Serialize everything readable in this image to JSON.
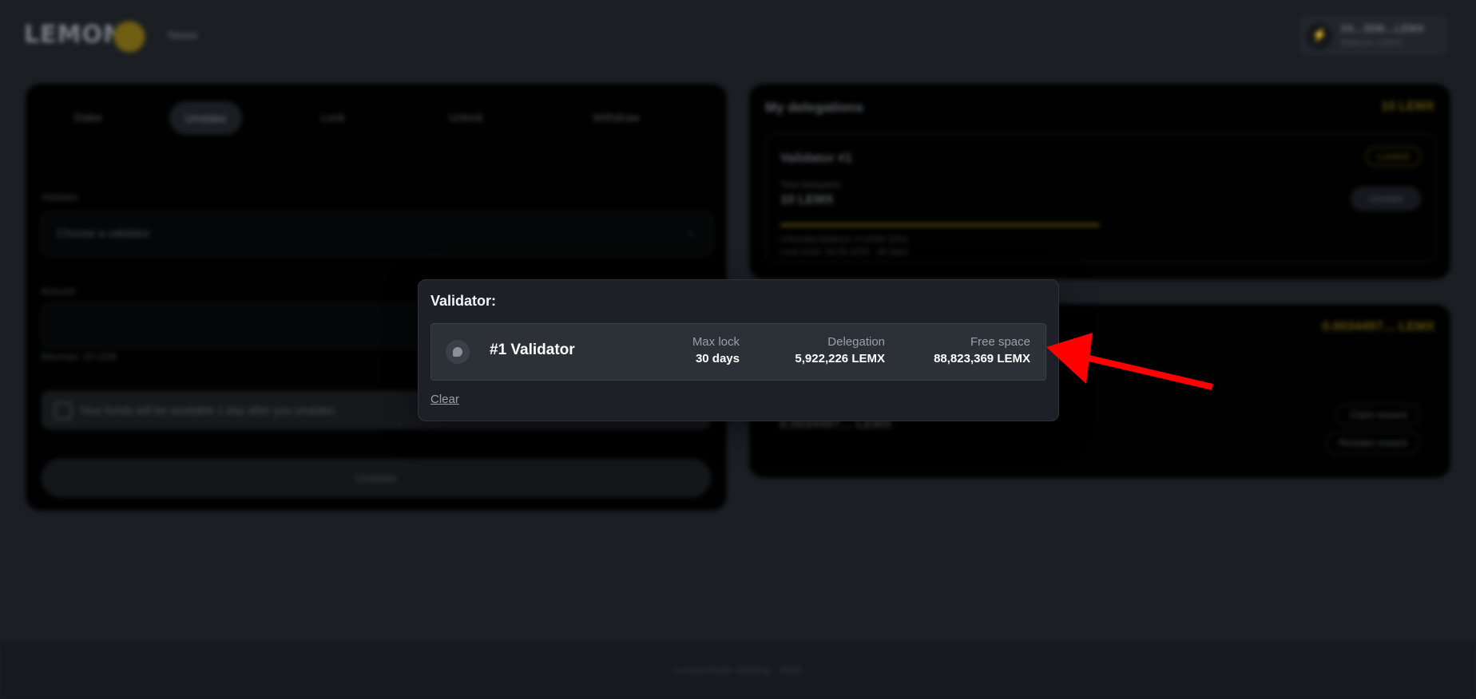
{
  "header": {
    "logo_text": "LEMON",
    "nav_news": "News",
    "wallet_address": "0X…5DB…LEMX",
    "wallet_sub": "Balance: LEMX"
  },
  "stake_panel": {
    "tabs": [
      "Stake",
      "Unstake",
      "Lock",
      "Unlock",
      "Withdraw"
    ],
    "active_tab": "Unstake",
    "validator_label": "Validator",
    "validator_placeholder": "Choose a validator",
    "amount_label": "Amount",
    "amount_hint": "Min/max: 10 LEM",
    "notice": "Your funds will be available 1 day after you unstake.",
    "submit_label": "Unstake"
  },
  "delegations_panel": {
    "title": "My delegations",
    "total": "10 LEMX",
    "card_title": "Validator #1",
    "badge": "Locked",
    "sub_label": "Total delegated",
    "value": "10 LEMX",
    "action_label": "Unstake",
    "line1": "Unlocked balance: 0 LEMX (0%)",
    "line2": "Lock ends: 30.06.2025 · 30 days"
  },
  "rewards_panel": {
    "amount": "0.0034497… LEMX",
    "value": "0.0034497… LEMX",
    "claim_label": "Claim reward",
    "restake_label": "Restake reward"
  },
  "footer": {
    "text": "LemonChain Staking · 2025"
  },
  "modal": {
    "title": "Validator:",
    "validators": [
      {
        "name": "#1 Validator",
        "max_lock_label": "Max lock",
        "max_lock": "30 days",
        "delegation_label": "Delegation",
        "delegation": "5,922,226 LEMX",
        "free_space_label": "Free space",
        "free_space": "88,823,369 LEMX"
      }
    ],
    "clear_label": "Clear"
  },
  "colors": {
    "background": "#1b1f24",
    "modal_bg": "#1d2127",
    "row_bg": "#2c3138",
    "annotation_arrow": "#ff0000",
    "accent_yellow": "#c9a91a"
  }
}
